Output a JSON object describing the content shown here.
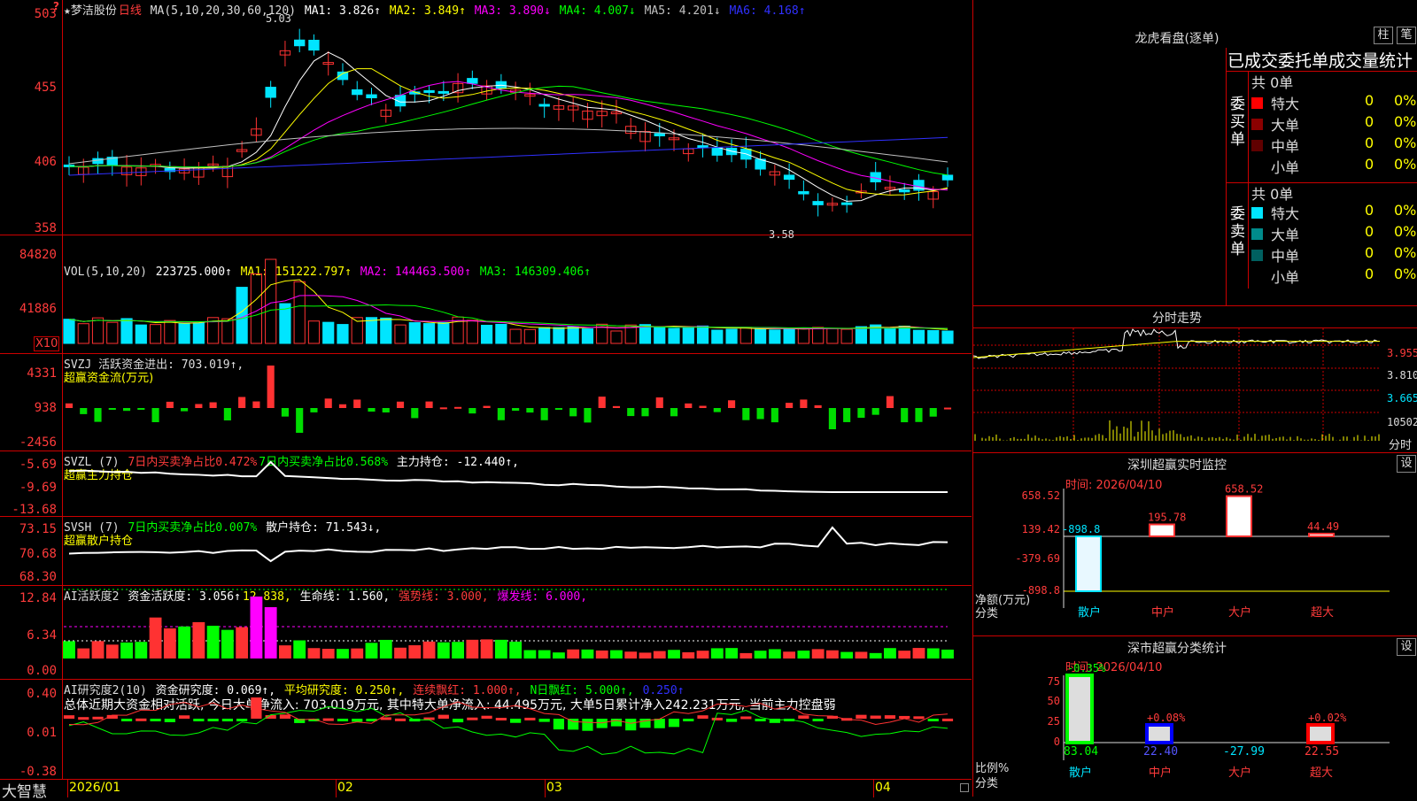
{
  "colors": {
    "up": "#ff3232",
    "down": "#00e5ff",
    "ma1": "#ffffff",
    "ma2": "#ffff00",
    "ma3": "#ff00ff",
    "ma4": "#00ff00",
    "ma5": "#c0c0c0",
    "ma6": "#3030ff",
    "grid": "#c00000"
  },
  "kline": {
    "title": "★梦洁股份",
    "period": "日线",
    "ma_label": "MA(5,10,20,30,60,120)",
    "ma_values": [
      "MA1: 3.826↑",
      "MA2: 3.849↑",
      "MA3: 3.890↓",
      "MA4: 4.007↓",
      "MA5: 4.201↓",
      "MA6: 4.168↑"
    ],
    "ticks": [
      "503",
      "455",
      "406",
      "358"
    ],
    "high_label": "5.03",
    "low_label": "3.58",
    "corner": "?"
  },
  "volume": {
    "header": "VOL(5,10,20)",
    "value": "223725.000↑",
    "ma": [
      "MA1: 151222.797↑",
      "MA2: 144463.500↑",
      "MA3: 146309.406↑"
    ],
    "ticks": [
      "84820",
      "41886"
    ],
    "unit": "X10"
  },
  "svzj": {
    "header": "SVZJ  活跃资金进出: 703.019↑,",
    "sub": "超赢资金流(万元)",
    "ticks": [
      "4331",
      "938",
      "-2456"
    ]
  },
  "svzl": {
    "header": "SVZL (7)",
    "items": [
      "7日内买卖净占比0.472%",
      "7日内买卖净占比0.568%",
      "主力持仓: -12.440↑,"
    ],
    "sub": "超赢主力持仓",
    "ticks": [
      "-5.69",
      "-9.69",
      "-13.68"
    ]
  },
  "svsh": {
    "header": "SVSH (7)",
    "items": [
      "7日内买卖净占比0.007%",
      "散户持仓: 71.543↓,"
    ],
    "sub": "超赢散户持仓",
    "ticks": [
      "73.15",
      "70.68",
      "68.30"
    ]
  },
  "ai1": {
    "header": "AI活跃度2",
    "items": [
      "资金活跃度: 3.056↑",
      "12.838,",
      "生命线: 1.560,",
      "强势线: 3.000,",
      "爆发线: 6.000,"
    ],
    "ticks": [
      "12.84",
      "6.34",
      "0.00"
    ]
  },
  "ai2": {
    "header": "AI研究度2(10)",
    "items": [
      "资金研究度: 0.069↑,",
      "平均研究度: 0.250↑,",
      "连续飘红: 1.000↑,",
      "N日飘红: 5.000↑,",
      "0.250↑"
    ],
    "sub": "总体近期大资金相对活跃, 今日大单净流入: 703.019万元, 其中特大单净流入: 44.495万元, 大单5日累计净入242.231万元, 当前主力控盘弱",
    "ticks": [
      "0.40",
      "0.01",
      "-0.38"
    ]
  },
  "xaxis": {
    "brand": "大智慧",
    "labels": [
      "2026/01",
      "02",
      "03",
      "04"
    ]
  },
  "dragon": {
    "title": "龙虎看盘(逐单)",
    "btn1": "柱",
    "btn2": "笔",
    "heading": "已成交委托单成交量统计",
    "buy_label": "委买单",
    "sell_label": "委卖单",
    "buy_total": "共 0单",
    "sell_total": "共 0单",
    "rows": [
      {
        "name": "特大",
        "vol": "0",
        "pct": "0%"
      },
      {
        "name": "大单",
        "vol": "0",
        "pct": "0%"
      },
      {
        "name": "中单",
        "vol": "0",
        "pct": "0%"
      },
      {
        "name": "小单",
        "vol": "0",
        "pct": "0%"
      }
    ]
  },
  "fenshi": {
    "title": "分时走势",
    "ticks": [
      "3.955",
      "3.810",
      "3.665"
    ],
    "vol_tick": "10502",
    "vol_label": "分时"
  },
  "szmon": {
    "title": "深圳超赢实时监控",
    "btn": "设",
    "time": "时间: 2026/04/10",
    "ticks": [
      "658.52",
      "139.42",
      "-379.69",
      "-898.8"
    ],
    "ylabel": "净额(万元)",
    "xlabel": "分类",
    "cats": [
      "散户",
      "中户",
      "大户",
      "超大"
    ],
    "values": [
      -898.8,
      195.78,
      658.52,
      44.49
    ],
    "labels": [
      "-898.8",
      "195.78",
      "658.52",
      "44.49"
    ]
  },
  "szcls": {
    "title": "深市超赢分类统计",
    "btn": "设",
    "time": "时间: 2026/04/10",
    "ticks": [
      "75",
      "50",
      "25",
      "0"
    ],
    "ylabel": "比例%",
    "xlabel": "分类",
    "cats": [
      "散户",
      "中户",
      "大户",
      "超大"
    ],
    "top": [
      "-0.35%",
      "+0.08%",
      "",
      "+0.02%"
    ],
    "bottom": [
      "83.04",
      "22.40",
      "-27.99",
      "22.55"
    ]
  }
}
